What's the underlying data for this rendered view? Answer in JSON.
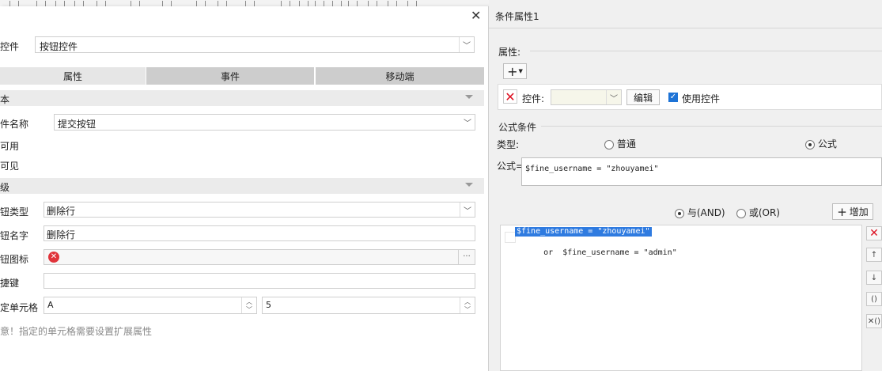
{
  "left_dialog": {
    "close_symbol": "✕",
    "control_label": "控件",
    "control_value": "按钮控件",
    "tabs": [
      {
        "label": "属性",
        "active": true
      },
      {
        "label": "事件",
        "active": false
      },
      {
        "label": "移动端",
        "active": false
      }
    ],
    "basic_section": "本",
    "name_label": "件名称",
    "name_value": "提交按钮",
    "enabled_label": "可用",
    "visible_label": "可见",
    "advanced_section": "级",
    "button_type_label": "钮类型",
    "button_type_value": "删除行",
    "button_name_label": "钮名字",
    "button_name_value": "删除行",
    "button_icon_label": "钮图标",
    "icon_more": "···",
    "shortcut_label": "捷键",
    "shortcut_value": "",
    "cell_label": "定单元格",
    "cell_col": "A",
    "cell_row": "5",
    "note": "意！指定的单元格需要设置扩展属性"
  },
  "right_panel": {
    "title": "条件属性1",
    "property_label": "属性:",
    "add_symbol": "+",
    "control_label": "控件:",
    "control_value": "",
    "edit_button": "编辑",
    "use_control_label": "使用控件",
    "use_control_checked": true,
    "formula_condition_title": "公式条件",
    "type_label": "类型:",
    "type_normal": "普通",
    "type_formula": "公式",
    "type_selected": "公式",
    "formula_label": "公式=",
    "formula_value": "$fine_username = \"zhouyamei\"",
    "and_label": "与(AND)",
    "or_label": "或(OR)",
    "logic_selected": "AND",
    "add_button": "增加",
    "conditions": [
      {
        "prefix": "",
        "text": "$fine_username = \"zhouyamei\"",
        "selected": true
      },
      {
        "prefix": "or",
        "text": "$fine_username = \"admin\"",
        "selected": false
      }
    ],
    "side_buttons": {
      "delete": "✕",
      "up": "↑",
      "down": "↓",
      "group": "()",
      "ungroup": "✕()"
    }
  }
}
